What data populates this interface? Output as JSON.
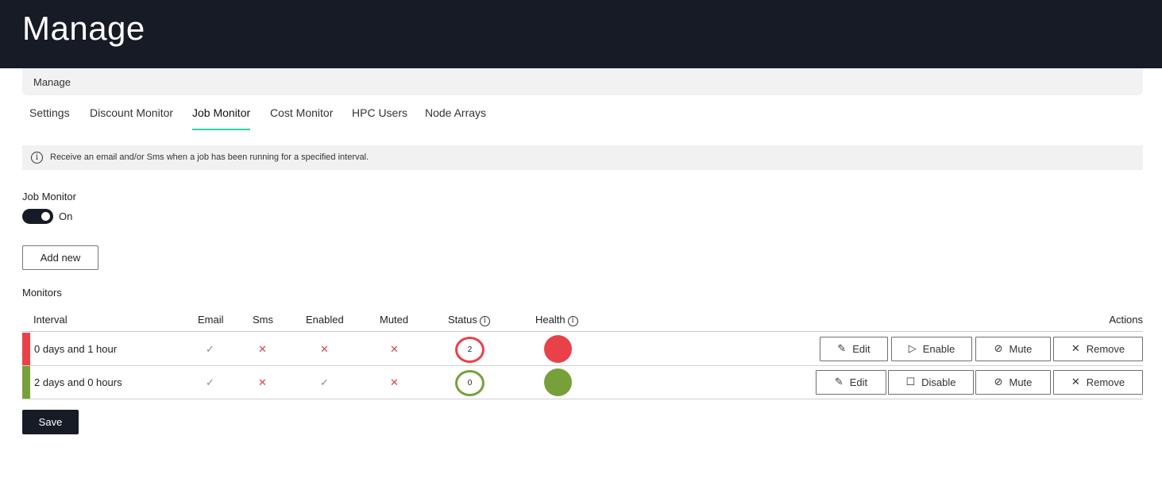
{
  "header": {
    "title": "Manage"
  },
  "breadcrumb": {
    "label": "Manage"
  },
  "tabs": [
    {
      "label": "Settings",
      "active": false
    },
    {
      "label": "Discount Monitor",
      "active": false
    },
    {
      "label": "Job Monitor",
      "active": true
    },
    {
      "label": "Cost Monitor",
      "active": false
    },
    {
      "label": "HPC Users",
      "active": false
    },
    {
      "label": "Node Arrays",
      "active": false
    }
  ],
  "info": {
    "icon": "info-icon",
    "text": "Receive an email and/or Sms when a job has been running for a specified interval."
  },
  "job_monitor": {
    "label": "Job Monitor",
    "toggle_state": "On"
  },
  "add_new_label": "Add new",
  "monitors": {
    "label": "Monitors",
    "columns": {
      "interval": "Interval",
      "email": "Email",
      "sms": "Sms",
      "enabled": "Enabled",
      "muted": "Muted",
      "status": "Status",
      "health": "Health",
      "actions": "Actions"
    },
    "rows": [
      {
        "interval": "0 days and 1 hour",
        "email": "check",
        "sms": "cross",
        "enabled": "cross",
        "muted": "cross",
        "status": "2",
        "health_color": "#e9414a",
        "stripe_color": "#e9414a",
        "actions": {
          "edit": "Edit",
          "toggle": "Enable",
          "mute": "Mute",
          "remove": "Remove"
        }
      },
      {
        "interval": "2 days and 0 hours",
        "email": "check",
        "sms": "cross",
        "enabled": "check",
        "muted": "cross",
        "status": "0",
        "health_color": "#78a03a",
        "stripe_color": "#78a03a",
        "actions": {
          "edit": "Edit",
          "toggle": "Disable",
          "mute": "Mute",
          "remove": "Remove"
        }
      }
    ]
  },
  "save_label": "Save",
  "colors": {
    "topbar": "#161b26",
    "active_tab_underline": "#2fd1a6",
    "error": "#e9414a",
    "ok": "#78a03a"
  }
}
